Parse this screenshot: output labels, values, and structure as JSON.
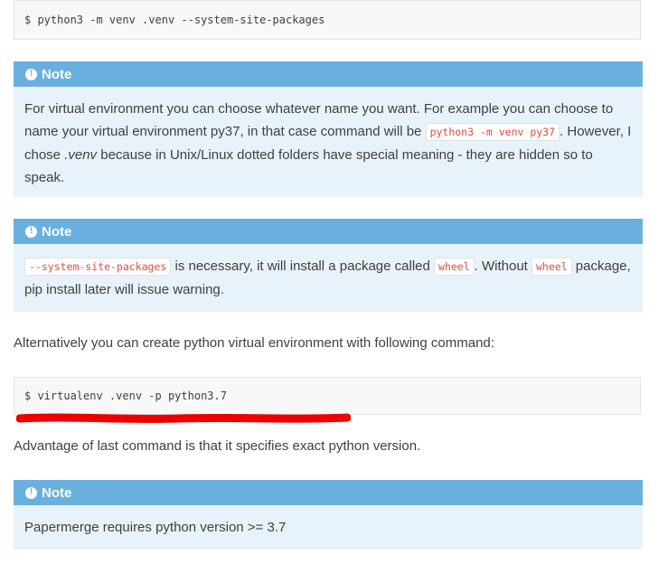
{
  "code_blocks": [
    {
      "text": "$ python3 -m venv .venv --system-site-packages"
    },
    {
      "text": "$ virtualenv .venv -p python3.7"
    }
  ],
  "note1": {
    "icon": "exclamation-circle-icon",
    "title": "Note",
    "part1": "For virtual environment you can choose whatever name you want. For example you can choose to name your virtual environment py37, in that case command will be ",
    "code": "python3 -m venv py37",
    "part2": ". However, I chose ",
    "em": ".venv",
    "part3": " because in Unix/Linux dotted folders have special meaning - they are hidden so to speak."
  },
  "note2": {
    "icon": "exclamation-circle-icon",
    "title": "Note",
    "code1": "--system-site-packages",
    "part1": " is necessary, it will install a package called ",
    "code2": "wheel",
    "part2": ". Without ",
    "code3": "wheel",
    "part3": " package, pip install later will issue warning."
  },
  "paragraphs": {
    "alternative": "Alternatively you can create python virtual environment with following command:",
    "advantage": "Advantage of last command is that it specifies exact python version."
  },
  "note3": {
    "icon": "exclamation-circle-icon",
    "title": "Note",
    "text": "Papermerge requires python version >= 3.7"
  },
  "colors": {
    "note_title_bg": "#6ab0de",
    "note_body_bg": "#e7f2fa",
    "code_bg": "#f8f8f8",
    "literal_text": "#e74c3c",
    "annotation_underline": "#ee0000"
  }
}
